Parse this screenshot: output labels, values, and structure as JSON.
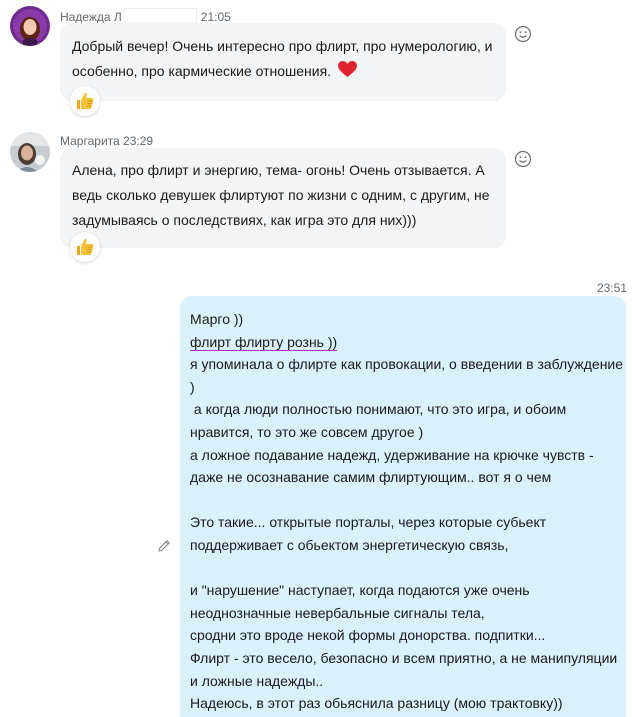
{
  "messages": [
    {
      "sender": "Надежда Л",
      "time": "21:05",
      "lines": [
        "Добрый вечер! Очень интересно про флирт, про нумерологию, и",
        "особенно, про кармические отношения."
      ],
      "emoji": "heart-emoji",
      "reaction": "thumbs-up-emoji"
    },
    {
      "sender": "Маргарита",
      "time": "23:29",
      "lines": [
        "Алена, про флирт и энергию, тема- огонь! Очень отзывается. А",
        "ведь сколько девушек флиртуют по жизни с одним, с другим, не",
        "задумываясь о последствиях, как игра это для них)))"
      ],
      "reaction": "thumbs-up-emoji"
    },
    {
      "time": "23:51",
      "lines": [
        "Марго ))",
        "флирт флирту рознь ))",
        "я упоминала о флирте как провокации, о введении в заблуждение",
        ")",
        " а когда люди полностью понимают, что это игра, и обоим",
        "нравится, то это же совсем другое )",
        "а ложное подавание надежд, удерживание на крючке чувств -",
        "даже не осознавание самим флиртующим.. вот я о чем",
        "",
        "Это такие... открытые порталы, через которые субьект",
        "поддерживает с обьектом энергетическую связь,",
        "",
        "и \"нарушение\" наступает, когда подаются уже очень",
        "неоднозначные невербальные сигналы тела,",
        "сродни это вроде некой формы донорства. подпитки...",
        "Флирт - это весело, безопасно и всем приятно, а не манипуляции",
        "и ложные надежды..",
        "Надеюсь, в этот раз обьяснила разницу (мою трактовку))"
      ]
    }
  ],
  "colors": {
    "incoming_bubble": "#f2f4f6",
    "outgoing_bubble": "#d9f0fd",
    "underline": "#b02fb8",
    "heart": "#e0242f"
  }
}
